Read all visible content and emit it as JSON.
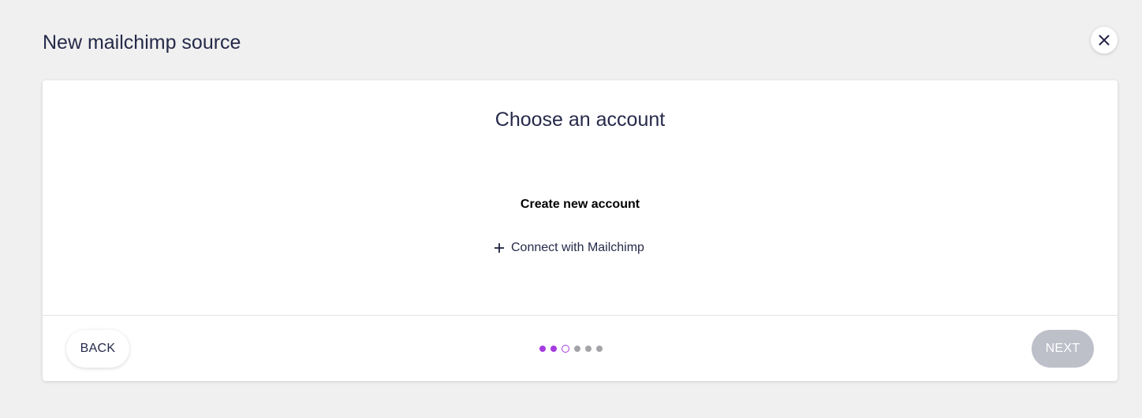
{
  "header": {
    "title": "New mailchimp source",
    "close_icon": "close-icon"
  },
  "card": {
    "title": "Choose an account",
    "section_title": "Create new account",
    "connect_label": "Connect with Mailchimp",
    "connect_icon": "plus-icon"
  },
  "footer": {
    "back_label": "BACK",
    "next_label": "NEXT",
    "next_enabled": false
  },
  "stepper": {
    "total_steps": 6,
    "current_step": 3,
    "steps": [
      "completed",
      "completed",
      "current",
      "pending",
      "pending",
      "pending"
    ]
  },
  "colors": {
    "accent": "#a63be0",
    "pending_dot": "#a4a4a8",
    "next_disabled_bg": "#bdbfc9",
    "text_primary": "#262a4a",
    "page_bg": "#f0f0f0"
  }
}
